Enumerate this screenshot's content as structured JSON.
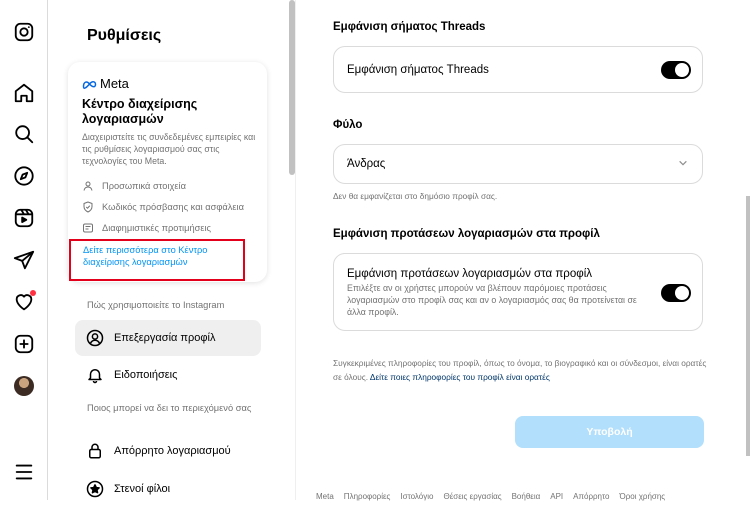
{
  "settings": {
    "title": "Ρυθμίσεις",
    "meta_card": {
      "brand": "Meta",
      "heading": "Κέντρο διαχείρισης λογαριασμών",
      "description": "Διαχειριστείτε τις συνδεδεμένες εμπειρίες και τις ρυθμίσεις λογαριασμού σας στις τεχνολογίες του Meta.",
      "items": [
        "Προσωπικά στοιχεία",
        "Κωδικός πρόσβασης και ασφάλεια",
        "Διαφημιστικές προτιμήσεις"
      ],
      "link": "Δείτε περισσότερα στο Κέντρο διαχείρισης λογαριασμών"
    },
    "section_how": "Πώς χρησιμοποιείτε το Instagram",
    "nav_how": [
      "Επεξεργασία προφίλ",
      "Ειδοποιήσεις"
    ],
    "section_who": "Ποιος μπορεί να δει το περιεχόμενό σας",
    "nav_who": [
      "Απόρρητο λογαριασμού",
      "Στενοί φίλοι"
    ]
  },
  "main": {
    "threads_heading": "Εμφάνιση σήματος Threads",
    "threads_label": "Εμφάνιση σήματος Threads",
    "threads_on": true,
    "gender_heading": "Φύλο",
    "gender_value": "Άνδρας",
    "gender_hint": "Δεν θα εμφανίζεται στο δημόσιο προφίλ σας.",
    "suggest_heading": "Εμφάνιση προτάσεων λογαριασμών στα προφίλ",
    "suggest_label": "Εμφάνιση προτάσεων λογαριασμών στα προφίλ",
    "suggest_desc": "Επιλέξτε αν οι χρήστες μπορούν να βλέπουν παρόμοιες προτάσεις λογαριασμών στο προφίλ σας και αν ο λογαριασμός σας θα προτείνεται σε άλλα προφίλ.",
    "suggest_on": true,
    "info_text": "Συγκεκριμένες πληροφορίες του προφίλ, όπως το όνομα, το βιογραφικό και οι σύνδεσμοι, είναι ορατές σε όλους.",
    "info_link": "Δείτε ποιες πληροφορίες του προφίλ είναι ορατές",
    "submit": "Υποβολή"
  },
  "footer": [
    "Meta",
    "Πληροφορίες",
    "Ιστολόγιο",
    "Θέσεις εργασίας",
    "Βοήθεια",
    "API",
    "Απόρρητο",
    "Όροι χρήσης"
  ],
  "colors": {
    "accent": "#0095f6",
    "submit_disabled": "#b2dffc",
    "highlight_box": "#e3001b"
  }
}
